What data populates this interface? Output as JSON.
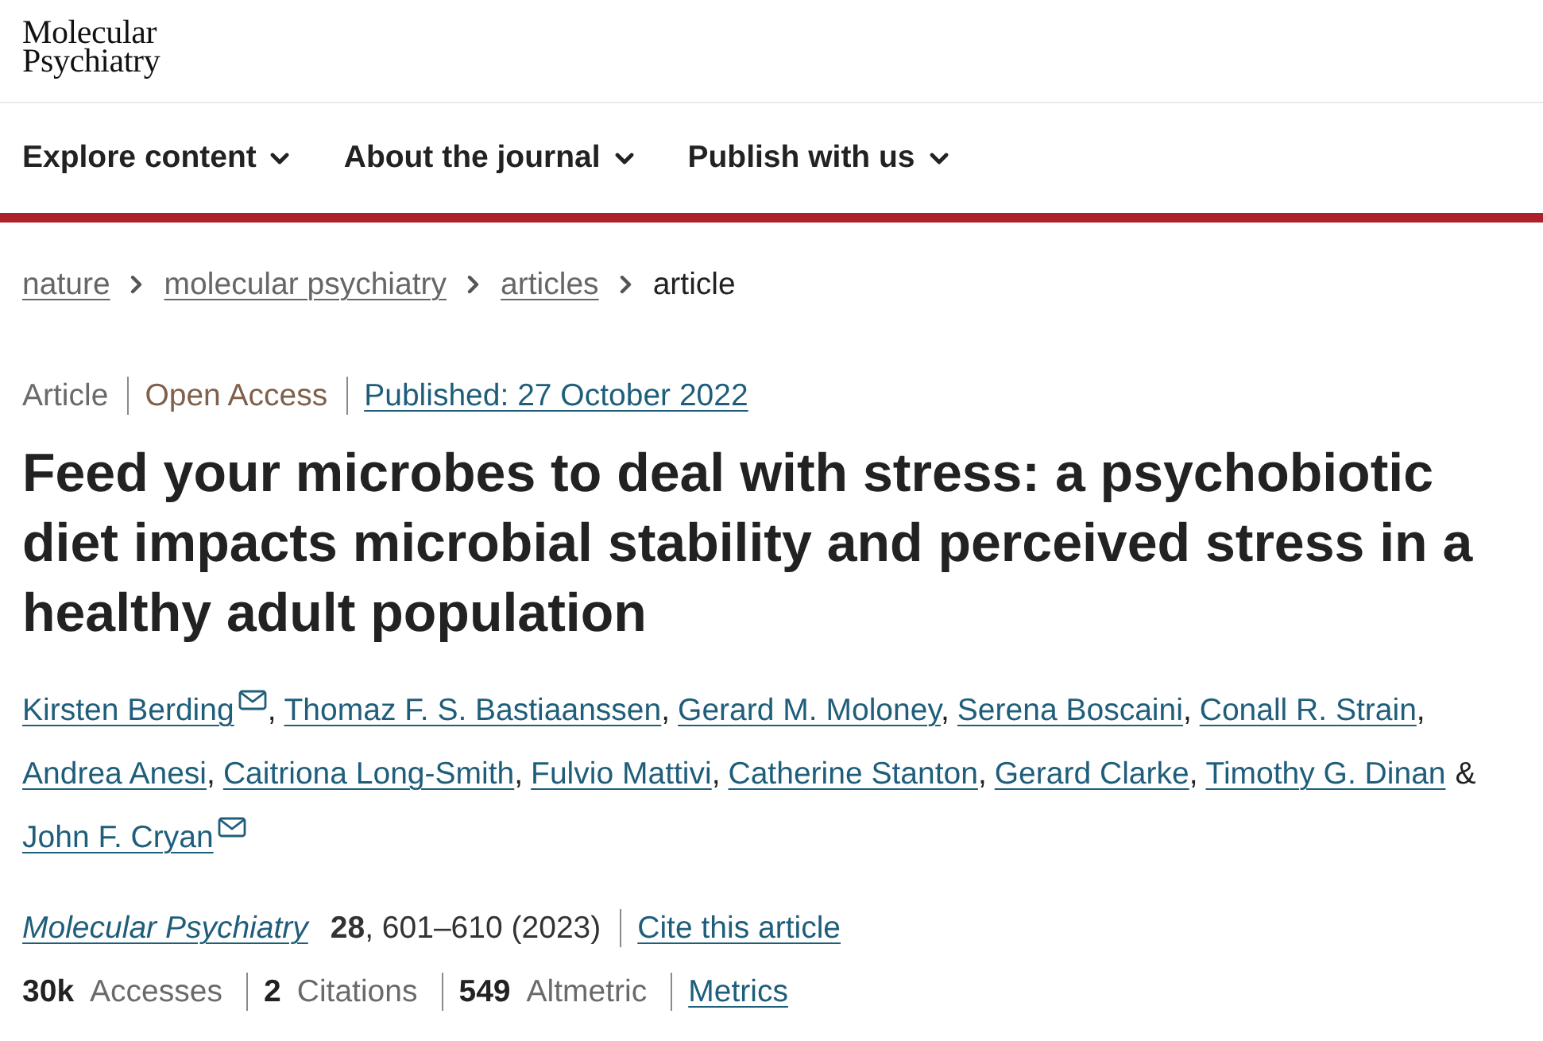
{
  "header": {
    "logo": "Molecular Psychiatry"
  },
  "nav": [
    {
      "label": "Explore content"
    },
    {
      "label": "About the journal"
    },
    {
      "label": "Publish with us"
    }
  ],
  "breadcrumbs": [
    {
      "label": "nature",
      "kind": "link"
    },
    {
      "label": "molecular psychiatry",
      "kind": "link"
    },
    {
      "label": "articles",
      "kind": "link"
    },
    {
      "label": "article",
      "kind": "current"
    }
  ],
  "article_meta": {
    "type": "Article",
    "access": "Open Access",
    "published": "Published: 27 October 2022"
  },
  "title": "Feed your microbes to deal with stress: a psychobiotic diet impacts microbial stability and perceived stress in a healthy adult population",
  "authors": [
    {
      "name": "Kirsten Berding",
      "email": true,
      "joiner": {
        "kind": "comma",
        "text": ","
      }
    },
    {
      "name": "Thomaz F. S. Bastiaanssen",
      "email": false,
      "joiner": {
        "kind": "comma",
        "text": ","
      }
    },
    {
      "name": "Gerard M. Moloney",
      "email": false,
      "joiner": {
        "kind": "comma",
        "text": ","
      }
    },
    {
      "name": "Serena Boscaini",
      "email": false,
      "joiner": {
        "kind": "comma",
        "text": ","
      }
    },
    {
      "name": "Conall R. Strain",
      "email": false,
      "joiner": {
        "kind": "comma",
        "text": ","
      }
    },
    {
      "name": "Andrea Anesi",
      "email": false,
      "joiner": {
        "kind": "comma",
        "text": ","
      }
    },
    {
      "name": "Caitriona Long-Smith",
      "email": false,
      "joiner": {
        "kind": "comma",
        "text": ","
      }
    },
    {
      "name": "Fulvio Mattivi",
      "email": false,
      "joiner": {
        "kind": "comma",
        "text": ","
      }
    },
    {
      "name": "Catherine Stanton",
      "email": false,
      "joiner": {
        "kind": "comma",
        "text": ","
      }
    },
    {
      "name": "Gerard Clarke",
      "email": false,
      "joiner": {
        "kind": "comma",
        "text": ","
      }
    },
    {
      "name": "Timothy G. Dinan",
      "email": false,
      "joiner": {
        "kind": "conjunction",
        "text": "&"
      }
    },
    {
      "name": "John F. Cryan",
      "email": true
    }
  ],
  "citation": {
    "journal": "Molecular Psychiatry",
    "details": "**28**, 601–610 (2023)",
    "cite_link": "Cite this article"
  },
  "metrics": [
    {
      "count": "30k",
      "label": "Accesses"
    },
    {
      "count": "2",
      "label": "Citations"
    },
    {
      "count": "549",
      "label": "Altmetric"
    }
  ],
  "metrics_link": "Metrics"
}
